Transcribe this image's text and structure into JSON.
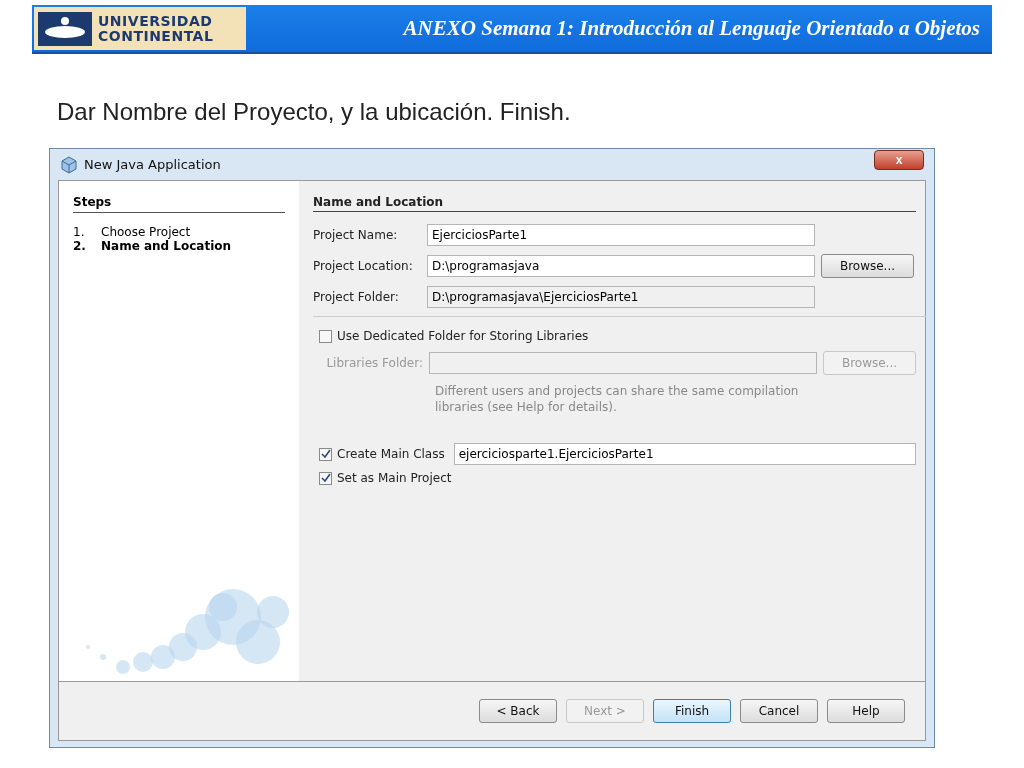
{
  "header": {
    "logo_lines": [
      "UNIVERSIDAD",
      "CONTINENTAL"
    ],
    "title": "ANEXO Semana 1: Introducción al Lenguaje Orientado a Objetos"
  },
  "instruction": "Dar Nombre del Proyecto, y la ubicación. Finish.",
  "dialog": {
    "title": "New Java Application",
    "close_label": "x",
    "steps_heading": "Steps",
    "steps": [
      {
        "number": "1.",
        "label": "Choose Project",
        "selected": false
      },
      {
        "number": "2.",
        "label": "Name and Location",
        "selected": true
      }
    ],
    "section_heading": "Name and Location",
    "fields": [
      {
        "label": "Project Name:",
        "value": "EjerciciosParte1",
        "kind": "input"
      },
      {
        "label": "Project Location:",
        "value": "D:\\programasjava",
        "kind": "input",
        "button": "Browse..."
      },
      {
        "label": "Project Folder:",
        "value": "D:\\programasjava\\EjerciciosParte1",
        "kind": "readonly"
      }
    ],
    "libraries": {
      "checked": false,
      "label": "Use Dedicated Folder for Storing Libraries",
      "field_label": "Libraries Folder:",
      "button": "Browse...",
      "note": "Different users and projects can share the same compilation libraries (see Help for details)."
    },
    "main_class": {
      "checked": true,
      "label": "Create Main Class",
      "value": "ejerciciosparte1.EjerciciosParte1"
    },
    "main_project": {
      "checked": true,
      "label": "Set as Main Project"
    },
    "buttons": [
      {
        "label": "< Back",
        "disabled": false,
        "default": false
      },
      {
        "label": "Next >",
        "disabled": true,
        "default": false
      },
      {
        "label": "Finish",
        "disabled": false,
        "default": true
      },
      {
        "label": "Cancel",
        "disabled": false,
        "default": false
      },
      {
        "label": "Help",
        "disabled": false,
        "default": false
      }
    ]
  }
}
